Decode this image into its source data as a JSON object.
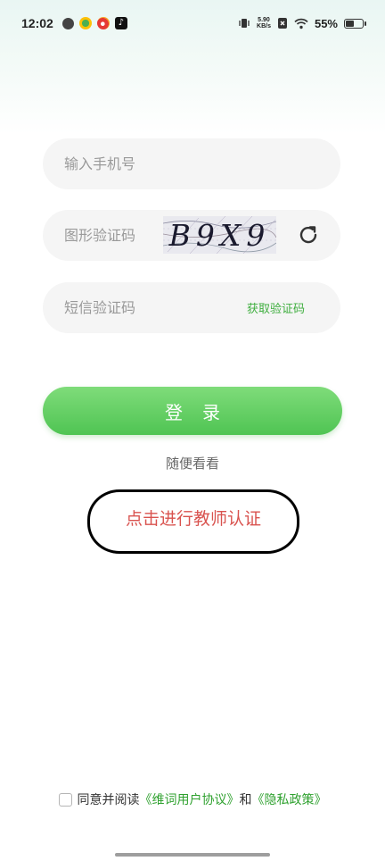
{
  "status_bar": {
    "time": "12:02",
    "net_speed_value": "5.90",
    "net_speed_unit": "KB/s",
    "battery": "55%",
    "battery_level": 0.55
  },
  "form": {
    "phone_placeholder": "输入手机号",
    "captcha_placeholder": "图形验证码",
    "captcha_text": "B9X9",
    "sms_placeholder": "短信验证码",
    "get_code_label": "获取验证码"
  },
  "login_label": "登录",
  "browse_label": "随便看看",
  "teacher_auth_label": "点击进行教师认证",
  "agreement": {
    "prefix": "同意并阅读",
    "user_agreement": "《维词用户协议》",
    "and": "和",
    "privacy_policy": "《隐私政策》"
  },
  "colors": {
    "accent_green": "#4fc453",
    "link_red": "#d9534f",
    "link_green": "#2fa12f"
  }
}
